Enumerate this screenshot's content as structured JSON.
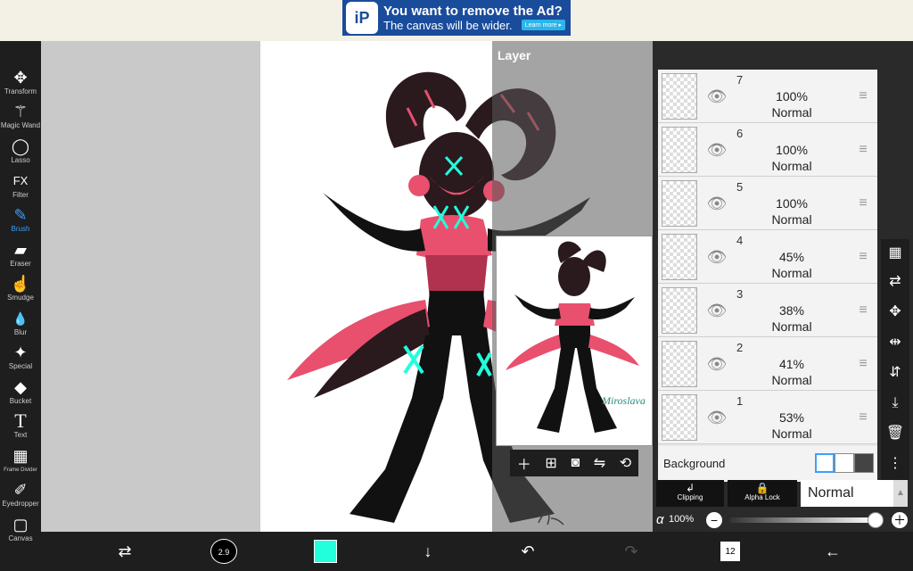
{
  "ad": {
    "logo": "iP",
    "title": "You want to remove the Ad?",
    "subtitle": "The canvas will be wider.",
    "learn_more": "Learn more ▸"
  },
  "toolbar": {
    "tools": [
      {
        "label": "Transform",
        "icon": "✥"
      },
      {
        "label": "Magic Wand",
        "icon": "⚚"
      },
      {
        "label": "Lasso",
        "icon": "◯"
      },
      {
        "label": "Filter",
        "icon": "FX"
      },
      {
        "label": "Brush",
        "icon": "✎"
      },
      {
        "label": "Eraser",
        "icon": "▰"
      },
      {
        "label": "Smudge",
        "icon": "☝"
      },
      {
        "label": "Blur",
        "icon": "💧"
      },
      {
        "label": "Special",
        "icon": "✦"
      },
      {
        "label": "Bucket",
        "icon": "◆"
      },
      {
        "label": "Text",
        "icon": "T"
      },
      {
        "label": "Frame Divider",
        "icon": "▦"
      },
      {
        "label": "Eyedropper",
        "icon": "✐"
      },
      {
        "label": "Canvas",
        "icon": "▢"
      }
    ],
    "active_tool": "Brush"
  },
  "layer_panel": {
    "title": "Layer",
    "layers": [
      {
        "num": "7",
        "opacity": "100%",
        "blend": "Normal"
      },
      {
        "num": "6",
        "opacity": "100%",
        "blend": "Normal"
      },
      {
        "num": "5",
        "opacity": "100%",
        "blend": "Normal"
      },
      {
        "num": "4",
        "opacity": "45%",
        "blend": "Normal"
      },
      {
        "num": "3",
        "opacity": "38%",
        "blend": "Normal"
      },
      {
        "num": "2",
        "opacity": "41%",
        "blend": "Normal"
      },
      {
        "num": "1",
        "opacity": "53%",
        "blend": "Normal"
      }
    ],
    "background_label": "Background",
    "clipping_label": "Clipping",
    "alpha_lock_label": "Alpha Lock",
    "blend_mode": "Normal",
    "alpha_symbol": "α",
    "alpha_value": "100%",
    "alpha_fraction": 1.0
  },
  "bottom": {
    "brush_size": "2.9",
    "color": "#22ffdd",
    "layer_count": "12"
  },
  "icons": {
    "preview_tools": [
      "plus-icon",
      "add-layer-icon",
      "camera-icon",
      "flip-icon",
      "rotate-icon"
    ],
    "side_tools": [
      "checker-icon",
      "transfer-icon",
      "move-icon",
      "flip-horizontal-icon",
      "flip-vertical-icon",
      "merge-down-icon",
      "trash-icon",
      "more-icon"
    ]
  }
}
